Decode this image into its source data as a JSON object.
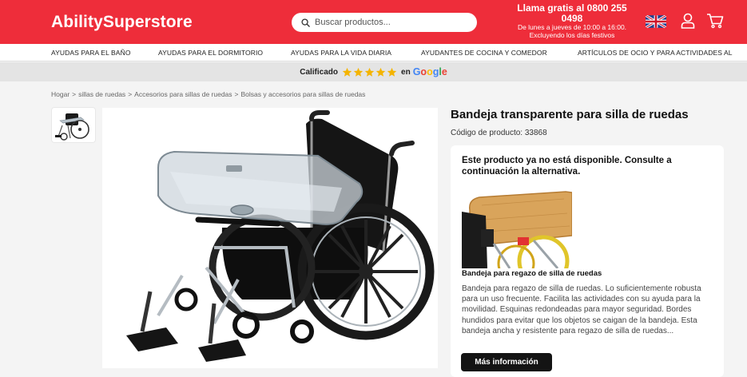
{
  "colors": {
    "brand_red": "#ee2d3a",
    "star_yellow": "#f4b400",
    "button_dark": "#141414"
  },
  "header": {
    "logo": "AbilitySuperstore",
    "search_placeholder": "Buscar productos...",
    "promo_line1": "Llama gratis al 0800 255",
    "promo_line2": "0498",
    "promo_line3": "De lunes a jueves de 10:00 a 16:00.",
    "promo_line4": "Excluyendo los días festivos",
    "icons": [
      "search-icon",
      "uk-flag-icon",
      "user-icon",
      "cart-icon"
    ]
  },
  "nav": {
    "items": [
      "AYUDAS PARA EL BAÑO",
      "AYUDAS PARA EL DORMITORIO",
      "AYUDAS PARA LA VIDA DIARIA",
      "AYUDANTES DE COCINA Y COMEDOR",
      "ARTÍCULOS DE OCIO Y PARA ACTIVIDADES AL"
    ]
  },
  "rating_bar": {
    "prefix": "Calificado",
    "stars": 5,
    "middle": "en",
    "brand": "Google"
  },
  "breadcrumb": [
    "Hogar",
    "sillas de ruedas",
    "Accesorios para sillas de ruedas",
    "Bolsas y accesorios para sillas de ruedas"
  ],
  "product": {
    "title": "Bandeja transparente para silla de ruedas",
    "code": "Código de producto: 33868"
  },
  "alternative": {
    "notice": "Este producto ya no está disponible. Consulte a continuación la alternativa.",
    "title": "Bandeja para regazo de silla de ruedas",
    "description": "Bandeja para regazo de silla de ruedas. Lo suficientemente robusta para un uso frecuente. Facilita las actividades con su ayuda para la movilidad. Esquinas redondeadas para mayor seguridad. Bordes hundidos para evitar que los objetos se caigan de la bandeja. Esta bandeja ancha y resistente para regazo de silla de ruedas...",
    "button_label": "Más información"
  }
}
